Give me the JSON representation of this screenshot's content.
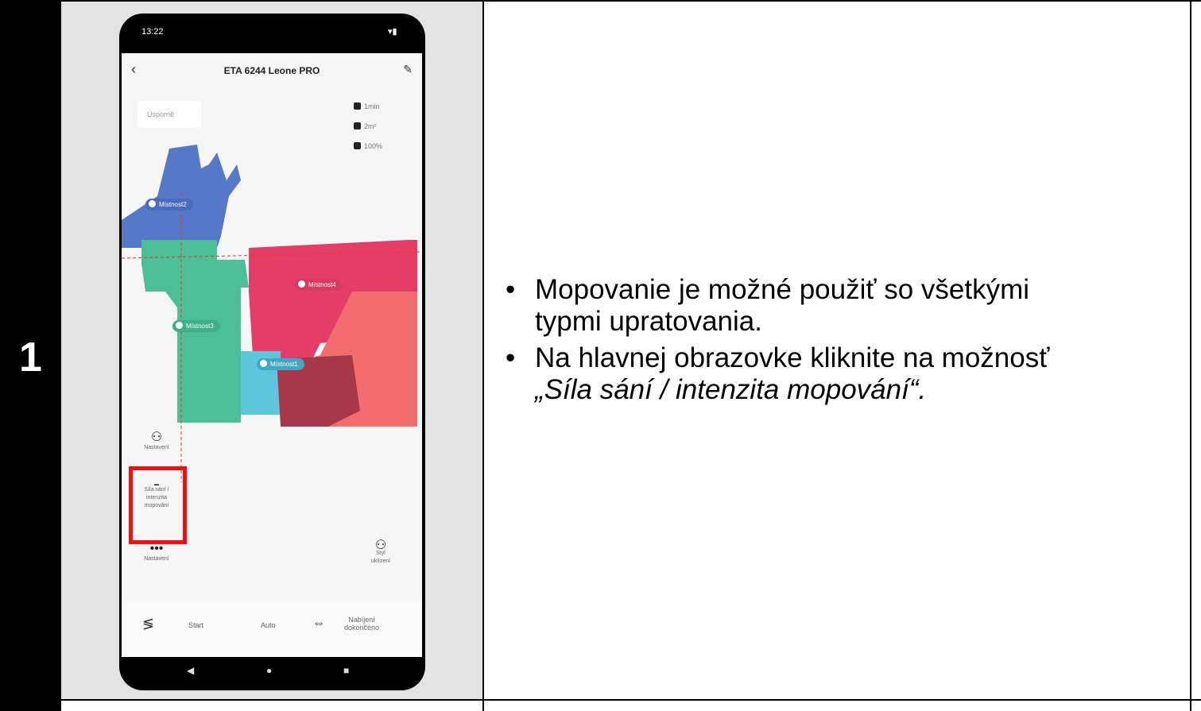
{
  "step": {
    "number": "1"
  },
  "phone": {
    "status_time": "13:22",
    "title": "ETA 6244 Leone PRO",
    "mode_chip": "Úsporně",
    "stats": [
      "1min",
      "2m²",
      "100%"
    ],
    "rooms": [
      "Místnost2",
      "Místnost4",
      "Místnost3",
      "Místnost1"
    ],
    "side_buttons": {
      "top_label": "Nastavení",
      "suction_label_1": "Síla sání /",
      "suction_label_2": "intenzita",
      "suction_label_3": "mopování",
      "more_label": "Nastavení",
      "style_label_1": "Styl",
      "style_label_2": "uklízení"
    },
    "bottom": {
      "start": "Start",
      "auto": "Auto",
      "charge_1": "Nabíjení",
      "charge_2": "dokončeno"
    },
    "colors": {
      "blue": "#5578c9",
      "green": "#4cbf98",
      "red": "#e53e66",
      "salmon": "#f26d6d",
      "cyan": "#5ec5dc",
      "highlight": "#e11111"
    }
  },
  "instructions": {
    "bullet_1_line_1": "Mopovanie je možné použiť so všetkými",
    "bullet_1_line_2": "typmi upratovania.",
    "bullet_2_line_1": "Na hlavnej obrazovke kliknite na možnosť",
    "bullet_2_line_2": "„Síla sání / intenzita mopování“."
  }
}
